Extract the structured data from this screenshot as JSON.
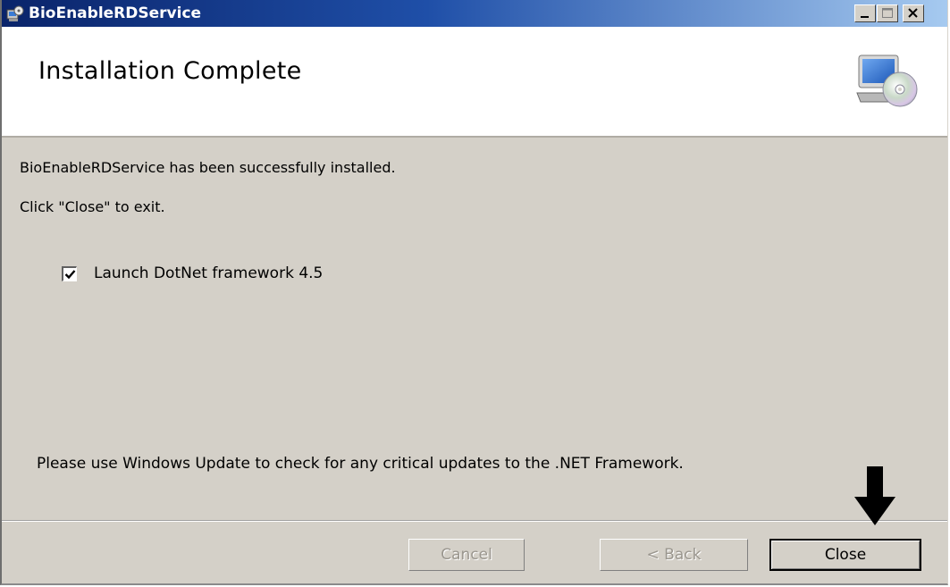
{
  "window": {
    "title": "BioEnableRDService"
  },
  "banner": {
    "title": "Installation Complete"
  },
  "content": {
    "success_message": "BioEnableRDService has been successfully installed.",
    "exit_instruction": "Click \"Close\" to exit.",
    "launch_checkbox": {
      "label": "Launch DotNet framework 4.5",
      "checked": true
    },
    "update_notice": "Please use Windows Update to check for any critical updates to the .NET Framework."
  },
  "buttons": {
    "cancel": {
      "label": "Cancel",
      "enabled": false
    },
    "back": {
      "label": "< Back",
      "enabled": false
    },
    "close": {
      "label": "Close",
      "enabled": true
    }
  },
  "icons": [
    "installer-app-icon",
    "minimize-icon",
    "maximize-icon",
    "close-icon",
    "computer-cd-icon",
    "checkmark-icon",
    "down-arrow-annotation"
  ],
  "colors": {
    "titlebar_start": "#0a246a",
    "titlebar_end": "#a6caf0",
    "dialog_bg": "#d4d0c8",
    "banner_bg": "#ffffff"
  }
}
